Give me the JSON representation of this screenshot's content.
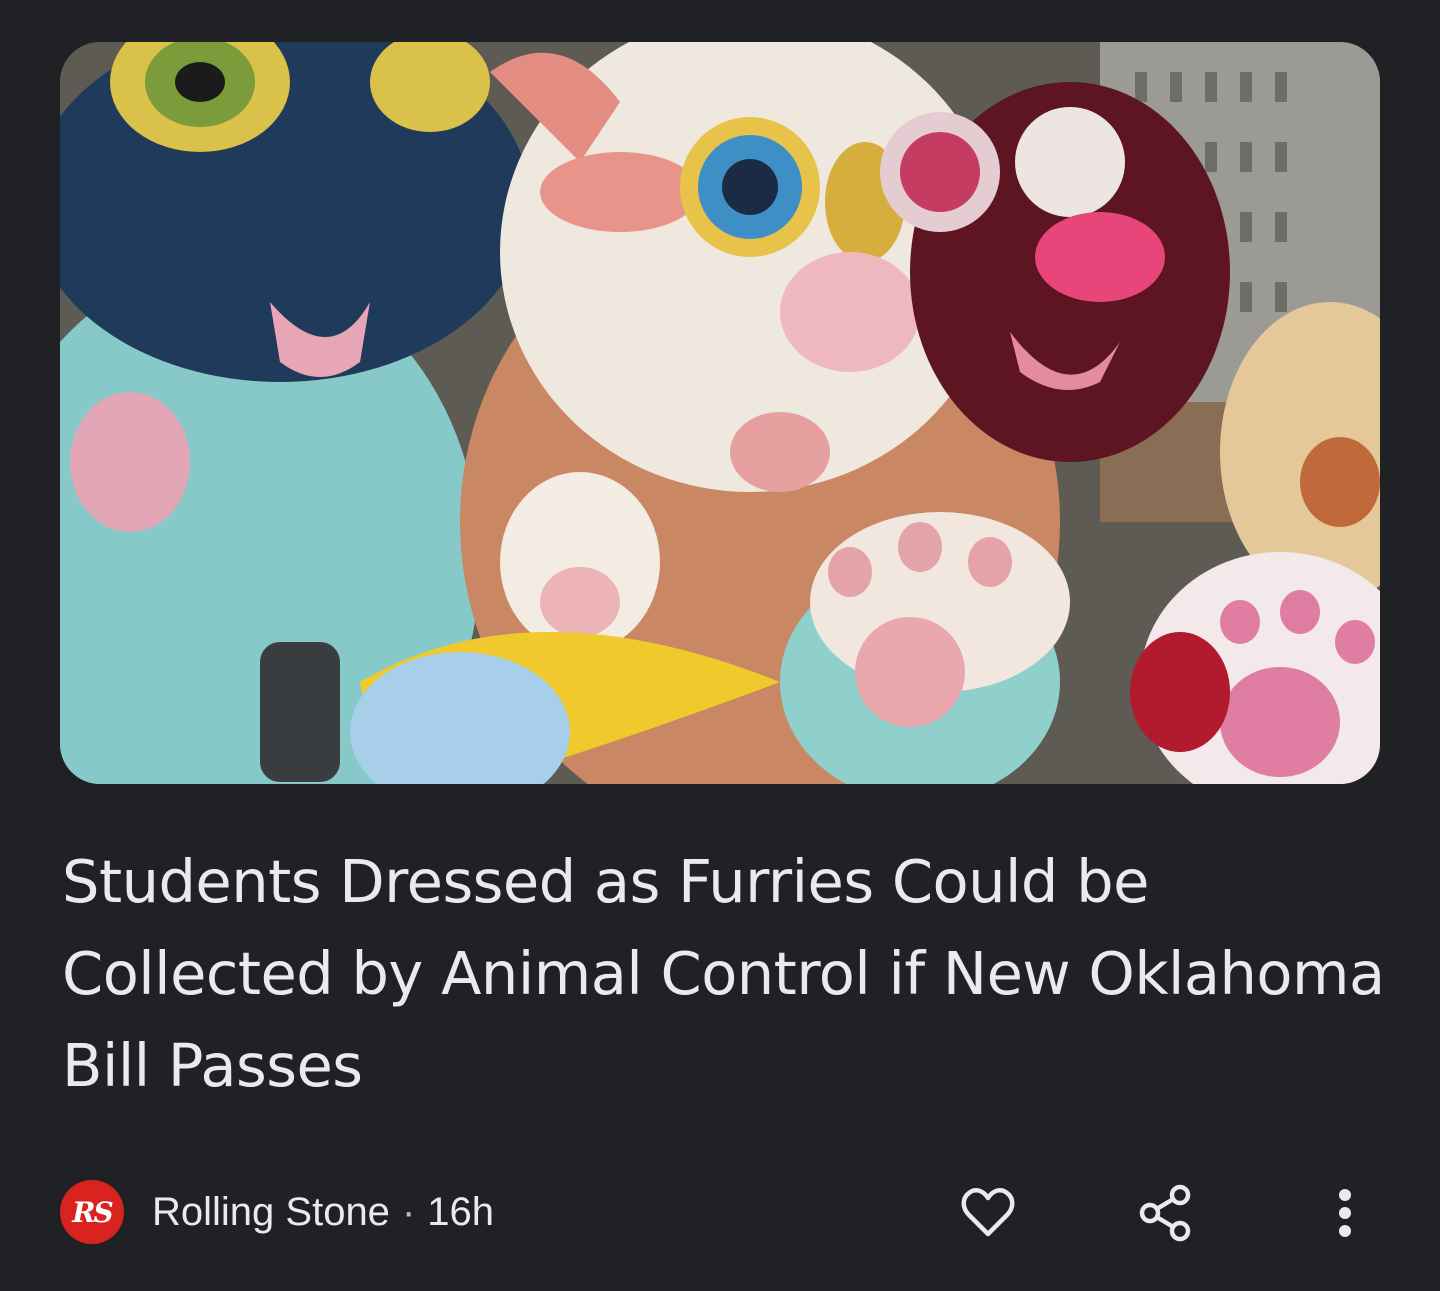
{
  "article": {
    "image_alt": "People in colorful fursuit costumes",
    "headline": "Students Dressed as Furries Could be Collected by Animal Control if New Oklahoma Bill Passes"
  },
  "meta": {
    "source_logo_text": "RS",
    "source_name": "Rolling Stone",
    "separator": "·",
    "time_ago": "16h"
  },
  "actions": {
    "like_icon": "heart-outline-icon",
    "share_icon": "share-icon",
    "more_icon": "more-vertical-icon"
  },
  "colors": {
    "background": "#202124",
    "text": "#e8eaed",
    "logo": "#d9231f"
  }
}
